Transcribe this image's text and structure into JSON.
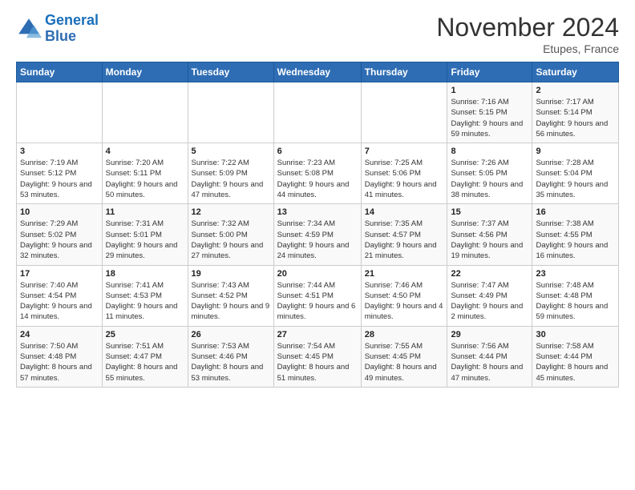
{
  "logo": {
    "line1": "General",
    "line2": "Blue"
  },
  "title": "November 2024",
  "subtitle": "Etupes, France",
  "days_of_week": [
    "Sunday",
    "Monday",
    "Tuesday",
    "Wednesday",
    "Thursday",
    "Friday",
    "Saturday"
  ],
  "weeks": [
    [
      {
        "day": "",
        "info": ""
      },
      {
        "day": "",
        "info": ""
      },
      {
        "day": "",
        "info": ""
      },
      {
        "day": "",
        "info": ""
      },
      {
        "day": "",
        "info": ""
      },
      {
        "day": "1",
        "info": "Sunrise: 7:16 AM\nSunset: 5:15 PM\nDaylight: 9 hours and 59 minutes."
      },
      {
        "day": "2",
        "info": "Sunrise: 7:17 AM\nSunset: 5:14 PM\nDaylight: 9 hours and 56 minutes."
      }
    ],
    [
      {
        "day": "3",
        "info": "Sunrise: 7:19 AM\nSunset: 5:12 PM\nDaylight: 9 hours and 53 minutes."
      },
      {
        "day": "4",
        "info": "Sunrise: 7:20 AM\nSunset: 5:11 PM\nDaylight: 9 hours and 50 minutes."
      },
      {
        "day": "5",
        "info": "Sunrise: 7:22 AM\nSunset: 5:09 PM\nDaylight: 9 hours and 47 minutes."
      },
      {
        "day": "6",
        "info": "Sunrise: 7:23 AM\nSunset: 5:08 PM\nDaylight: 9 hours and 44 minutes."
      },
      {
        "day": "7",
        "info": "Sunrise: 7:25 AM\nSunset: 5:06 PM\nDaylight: 9 hours and 41 minutes."
      },
      {
        "day": "8",
        "info": "Sunrise: 7:26 AM\nSunset: 5:05 PM\nDaylight: 9 hours and 38 minutes."
      },
      {
        "day": "9",
        "info": "Sunrise: 7:28 AM\nSunset: 5:04 PM\nDaylight: 9 hours and 35 minutes."
      }
    ],
    [
      {
        "day": "10",
        "info": "Sunrise: 7:29 AM\nSunset: 5:02 PM\nDaylight: 9 hours and 32 minutes."
      },
      {
        "day": "11",
        "info": "Sunrise: 7:31 AM\nSunset: 5:01 PM\nDaylight: 9 hours and 29 minutes."
      },
      {
        "day": "12",
        "info": "Sunrise: 7:32 AM\nSunset: 5:00 PM\nDaylight: 9 hours and 27 minutes."
      },
      {
        "day": "13",
        "info": "Sunrise: 7:34 AM\nSunset: 4:59 PM\nDaylight: 9 hours and 24 minutes."
      },
      {
        "day": "14",
        "info": "Sunrise: 7:35 AM\nSunset: 4:57 PM\nDaylight: 9 hours and 21 minutes."
      },
      {
        "day": "15",
        "info": "Sunrise: 7:37 AM\nSunset: 4:56 PM\nDaylight: 9 hours and 19 minutes."
      },
      {
        "day": "16",
        "info": "Sunrise: 7:38 AM\nSunset: 4:55 PM\nDaylight: 9 hours and 16 minutes."
      }
    ],
    [
      {
        "day": "17",
        "info": "Sunrise: 7:40 AM\nSunset: 4:54 PM\nDaylight: 9 hours and 14 minutes."
      },
      {
        "day": "18",
        "info": "Sunrise: 7:41 AM\nSunset: 4:53 PM\nDaylight: 9 hours and 11 minutes."
      },
      {
        "day": "19",
        "info": "Sunrise: 7:43 AM\nSunset: 4:52 PM\nDaylight: 9 hours and 9 minutes."
      },
      {
        "day": "20",
        "info": "Sunrise: 7:44 AM\nSunset: 4:51 PM\nDaylight: 9 hours and 6 minutes."
      },
      {
        "day": "21",
        "info": "Sunrise: 7:46 AM\nSunset: 4:50 PM\nDaylight: 9 hours and 4 minutes."
      },
      {
        "day": "22",
        "info": "Sunrise: 7:47 AM\nSunset: 4:49 PM\nDaylight: 9 hours and 2 minutes."
      },
      {
        "day": "23",
        "info": "Sunrise: 7:48 AM\nSunset: 4:48 PM\nDaylight: 8 hours and 59 minutes."
      }
    ],
    [
      {
        "day": "24",
        "info": "Sunrise: 7:50 AM\nSunset: 4:48 PM\nDaylight: 8 hours and 57 minutes."
      },
      {
        "day": "25",
        "info": "Sunrise: 7:51 AM\nSunset: 4:47 PM\nDaylight: 8 hours and 55 minutes."
      },
      {
        "day": "26",
        "info": "Sunrise: 7:53 AM\nSunset: 4:46 PM\nDaylight: 8 hours and 53 minutes."
      },
      {
        "day": "27",
        "info": "Sunrise: 7:54 AM\nSunset: 4:45 PM\nDaylight: 8 hours and 51 minutes."
      },
      {
        "day": "28",
        "info": "Sunrise: 7:55 AM\nSunset: 4:45 PM\nDaylight: 8 hours and 49 minutes."
      },
      {
        "day": "29",
        "info": "Sunrise: 7:56 AM\nSunset: 4:44 PM\nDaylight: 8 hours and 47 minutes."
      },
      {
        "day": "30",
        "info": "Sunrise: 7:58 AM\nSunset: 4:44 PM\nDaylight: 8 hours and 45 minutes."
      }
    ]
  ]
}
